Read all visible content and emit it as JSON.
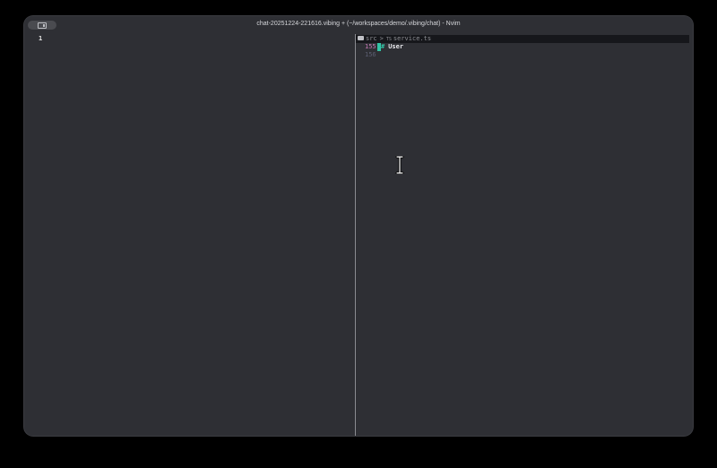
{
  "window": {
    "title": "chat-20251224-221616.vibing + (~/workspaces/demo/.vibing/chat) - Nvim"
  },
  "left_pane": {
    "lines": [
      {
        "number": "1",
        "text": ""
      }
    ]
  },
  "right_pane": {
    "breadcrumb": {
      "folder": "src",
      "separator": ">",
      "file_icon": "TS",
      "file": "service.ts"
    },
    "lines": [
      {
        "number": "155",
        "marker": "#",
        "text": "User"
      },
      {
        "number": "156",
        "text": ""
      }
    ]
  },
  "icons": {
    "sidebar": "sidebar-toggle-icon",
    "folder": "folder-icon",
    "cursor": "text-cursor-icon"
  },
  "colors": {
    "background": "#2e2f34",
    "line_number": "#c77ab6",
    "line_number_dim": "#5d5f73",
    "accent": "#33c4a6",
    "winbar": "#16171b"
  }
}
